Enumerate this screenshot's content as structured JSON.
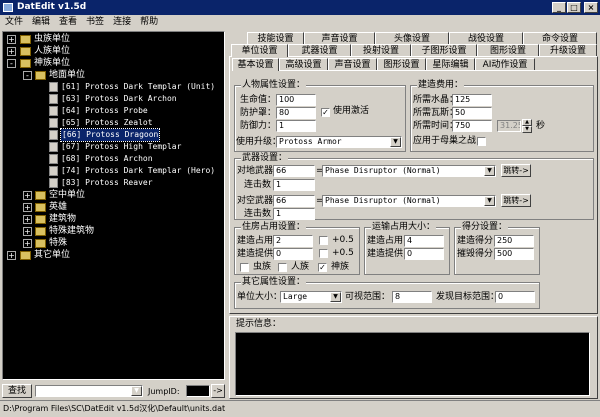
{
  "app": {
    "title": "DatEdit v1.5d"
  },
  "menu": [
    "文件",
    "编辑",
    "查看",
    "书签",
    "连接",
    "帮助"
  ],
  "tree": {
    "items": [
      {
        "text": "虫族单位",
        "expander": "+"
      },
      {
        "text": "人族单位",
        "expander": "+"
      },
      {
        "text": "神族单位",
        "expander": "-"
      },
      {
        "text": "地面单位",
        "expander": "-"
      },
      {
        "text": "[61] Protoss Dark Templar (Unit)"
      },
      {
        "text": "[63] Protoss Dark Archon"
      },
      {
        "text": "[64] Protoss Probe"
      },
      {
        "text": "[65] Protoss Zealot"
      },
      {
        "text": "[66] Protoss Dragoon",
        "selected": true
      },
      {
        "text": "[67] Protoss High Templar"
      },
      {
        "text": "[68] Protoss Archon"
      },
      {
        "text": "[74] Protoss Dark Templar (Hero)"
      },
      {
        "text": "[83] Protoss Reaver"
      },
      {
        "text": "空中单位",
        "expander": "+"
      },
      {
        "text": "英雄",
        "expander": "+"
      },
      {
        "text": "建筑物",
        "expander": "+"
      },
      {
        "text": "特殊建筑物",
        "expander": "+"
      },
      {
        "text": "特殊",
        "expander": "+"
      },
      {
        "text": "其它单位",
        "expander": "+"
      }
    ]
  },
  "find": {
    "button": "查找",
    "jump_label": "JumpID:",
    "go": "->",
    "value": ""
  },
  "tabs_row1": [
    "技能设置",
    "声音设置",
    "头像设置",
    "战役设置",
    "命令设置"
  ],
  "tabs_row2": [
    "单位设置",
    "武器设置",
    "投射设置",
    "子图形设置",
    "图形设置",
    "升级设置"
  ],
  "subtabs": [
    "基本设置",
    "高级设置",
    "声音设置",
    "图形设置",
    "星际编辑",
    "AI动作设置"
  ],
  "unit_attr": {
    "title": "人物属性设置：",
    "hp_label": "生命值：",
    "hp": "100",
    "shield_label": "防护罩：",
    "shield": "80",
    "armor_label": "防御力：",
    "armor": "1",
    "use_shield": "使用激活",
    "upgrade_label": "使用升级：",
    "upgrade": "Protoss Armor"
  },
  "cost": {
    "title": "建造费用：",
    "mineral_label": "所需水晶：",
    "mineral": "125",
    "gas_label": "所需瓦斯：",
    "gas": "50",
    "time_label": "所需时间：",
    "time": "750",
    "seconds": "31.25",
    "seconds_unit": "秒",
    "carrier": "应用于母巢之战"
  },
  "weapons": {
    "title": "武器设置：",
    "ground_label": "对地武器",
    "ground_id": "66",
    "ground_name": "Phase Disruptor (Normal)",
    "ground_hits_label": "连击数",
    "ground_hits": "1",
    "air_label": "对空武器",
    "air_id": "66",
    "air_name": "Phase Disruptor (Normal)",
    "air_hits_label": "连击数",
    "air_hits": "1",
    "jump": "跳转->"
  },
  "supply": {
    "title": "住房占用设置：",
    "req_label": "建造占用",
    "req": "2",
    "prov_label": "建造提供",
    "prov": "0",
    "half": "+0.5",
    "zerg": "虫族",
    "terran": "人族",
    "protoss": "神族"
  },
  "transport": {
    "title": "运输占用大小：",
    "req_label": "建造占用",
    "req": "4",
    "prov_label": "建造提供",
    "prov": "0"
  },
  "score": {
    "title": "得分设置：",
    "build_label": "建造得分",
    "build": "250",
    "kill_label": "摧毁得分",
    "kill": "500"
  },
  "other": {
    "title": "其它属性设置：",
    "size_label": "单位大小：",
    "size": "Large",
    "sight_label": "可视范围：",
    "sight": "8",
    "target_label": "发现目标范围：",
    "target": "0"
  },
  "hint": {
    "title": "提示信息："
  },
  "status": "D:\\Program Files\\SC\\DatEdit v1.5d汉化\\Default\\units.dat"
}
